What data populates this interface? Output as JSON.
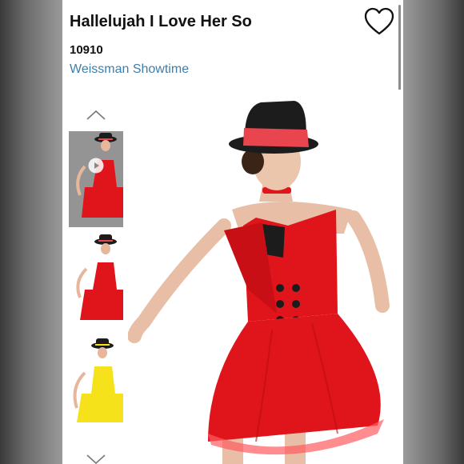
{
  "product": {
    "title": "Hallelujah I Love Her So",
    "sku": "10910",
    "brand": "Weissman Showtime"
  },
  "colors": {
    "brand_link": "#3f7ea8",
    "costume_red": "#e0151c",
    "costume_yellow": "#f5e21a",
    "hat_black": "#1c1c1c",
    "hat_band": "#e8454f"
  },
  "icons": {
    "favorite": "heart-outline-icon",
    "thumb_up": "chevron-up-icon",
    "thumb_down": "chevron-down-icon",
    "video": "play-icon"
  },
  "thumbnails": [
    {
      "label": "red costume video",
      "has_video": true
    },
    {
      "label": "red costume"
    },
    {
      "label": "yellow costume"
    }
  ]
}
